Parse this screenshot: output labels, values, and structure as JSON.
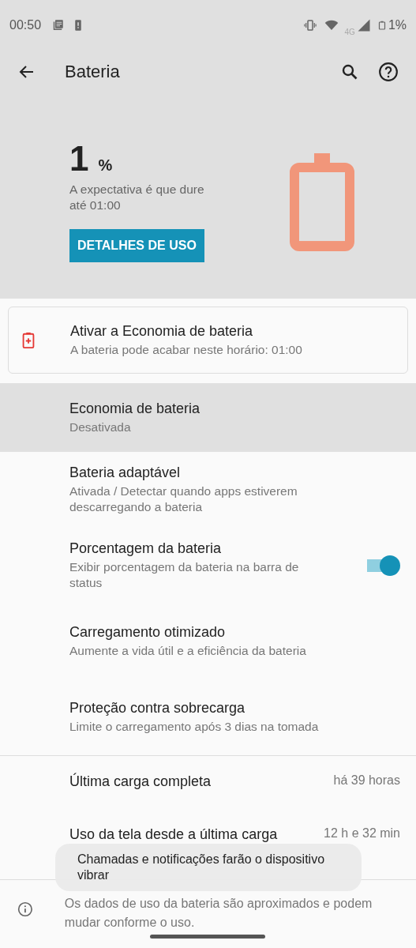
{
  "status_bar": {
    "time": "00:50",
    "network": "4G",
    "battery": "1%"
  },
  "toolbar": {
    "title": "Bateria"
  },
  "summary": {
    "percent": "1",
    "unit": "%",
    "estimate": "A expectativa é que dure até 01:00",
    "button": "DETALHES DE USO",
    "level": 0.01
  },
  "suggestion": {
    "title": "Ativar a Economia de bateria",
    "subtitle": "A bateria pode acabar neste horário: 01:00"
  },
  "settings": [
    {
      "kind": "plain",
      "title": "Economia de bateria",
      "subtitle": "Desativada",
      "selected": true
    },
    {
      "kind": "plain",
      "title": "Bateria adaptável",
      "subtitle": "Ativada / Detectar quando apps estiverem descarregando a bateria",
      "selected": false
    },
    {
      "kind": "switch",
      "title": "Porcentagem da bateria",
      "subtitle": "Exibir porcentagem da bateria na barra de status",
      "selected": false,
      "on": true
    },
    {
      "kind": "plain",
      "title": "Carregamento otimizado",
      "subtitle": "Aumente a vida útil e a eficiência da bateria",
      "selected": false
    },
    {
      "kind": "plain",
      "title": "Proteção contra sobrecarga",
      "subtitle": "Limite o carregamento após 3 dias na tomada",
      "selected": false
    }
  ],
  "usage": [
    {
      "title": "Última carga completa",
      "value": "há 39 horas"
    },
    {
      "title": "Uso da tela desde a última carga",
      "value": "12 h e 32 min"
    }
  ],
  "footer": "Os dados de uso da bateria são aproximados e podem mudar conforme o uso.",
  "toast": "Chamadas e notificações farão o dispositivo vibrar"
}
